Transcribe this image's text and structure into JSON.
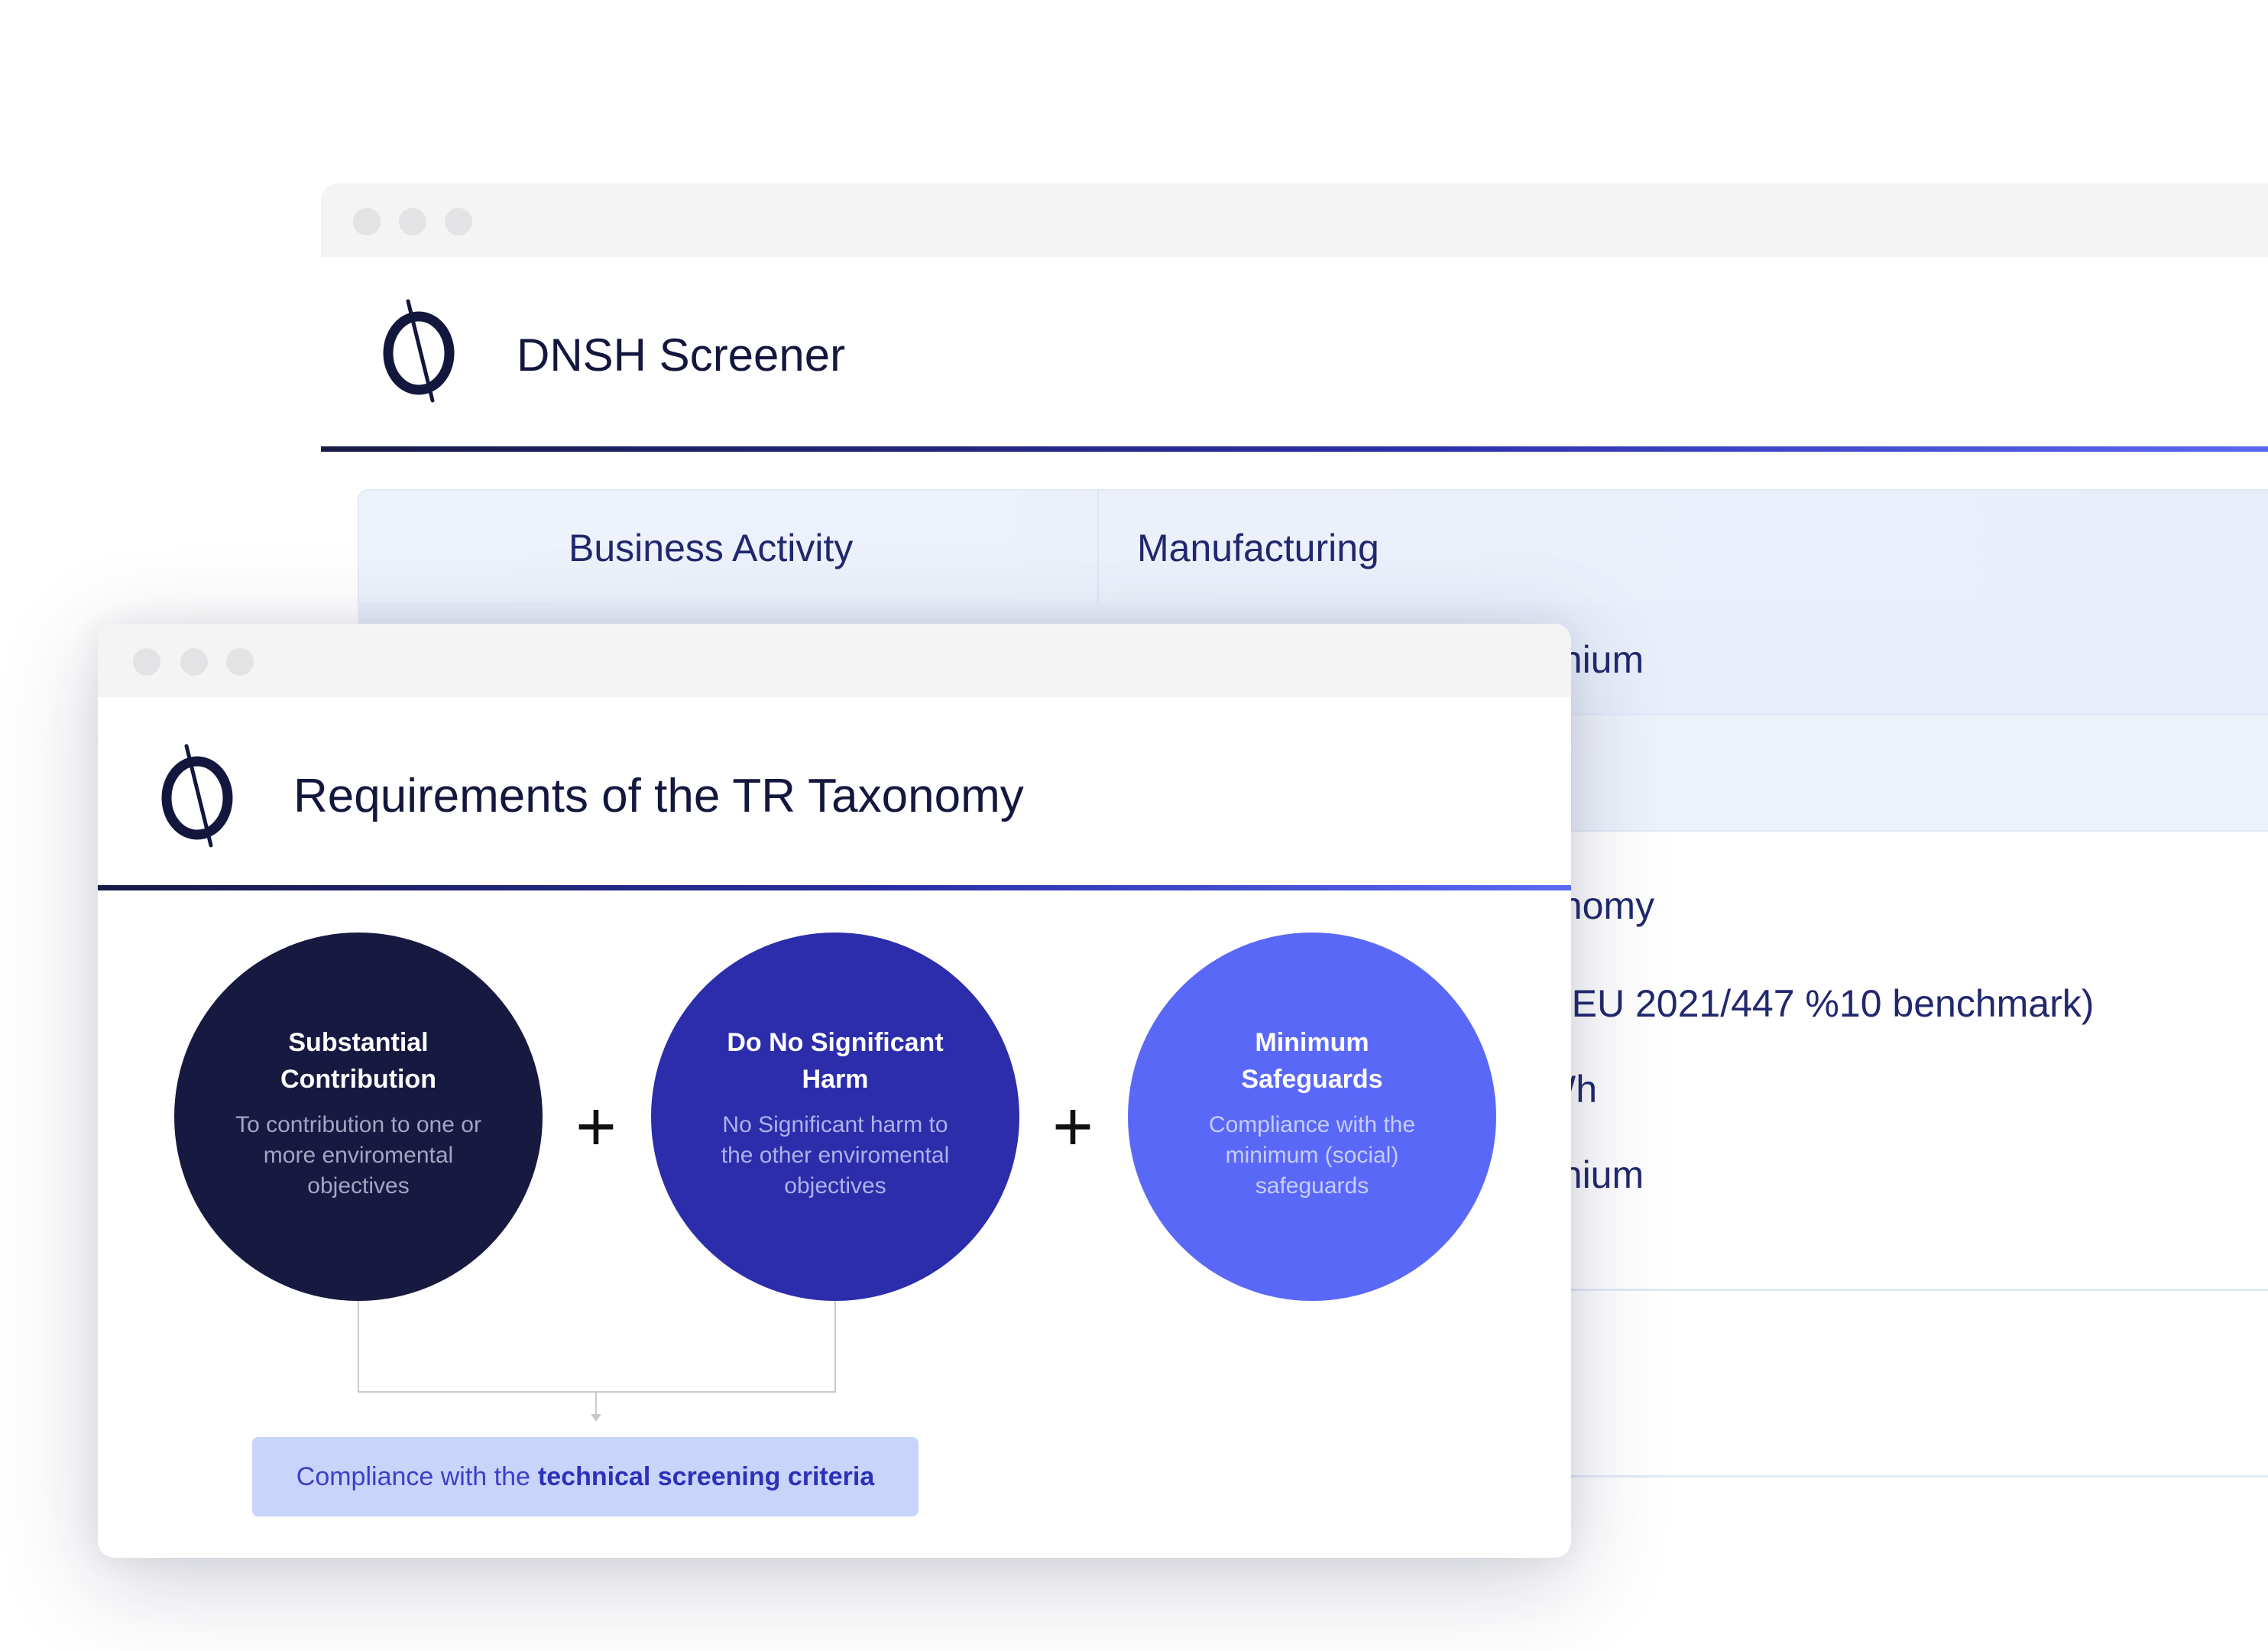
{
  "back_window": {
    "title": "DNSH Screener",
    "table": {
      "row1": {
        "label": "Business Activity",
        "value": "Manufacturing"
      },
      "row2_value_partial": "minium",
      "lines_partial": [
        "xonomy",
        "yi (EU 2021/447 %10 benchmark)",
        "kWh",
        "minium"
      ]
    }
  },
  "front_window": {
    "title": "Requirements of the TR Taxonomy",
    "circles": [
      {
        "title_line1": "Substantial",
        "title_line2": "Contribution",
        "desc": "To contribution to one or more enviromental objectives",
        "color": "#181941"
      },
      {
        "title_line1": "Do No Significant",
        "title_line2": "Harm",
        "desc": "No Significant  harm to the other enviromental objectives",
        "color": "#2b2dab"
      },
      {
        "title_line1": "Minimum",
        "title_line2": "Safeguards",
        "desc": "Compliance with the minimum (social) safeguards",
        "color": "#5a68f8"
      }
    ],
    "plus_symbol": "+",
    "result": {
      "prefix": "Compliance with the",
      "emphasis": "technical screening criteria"
    }
  },
  "colors": {
    "accent_dark": "#14173d",
    "accent_blue": "#2b2dab",
    "accent_light": "#5a68f8",
    "pill_bg": "#c9d4fb"
  }
}
